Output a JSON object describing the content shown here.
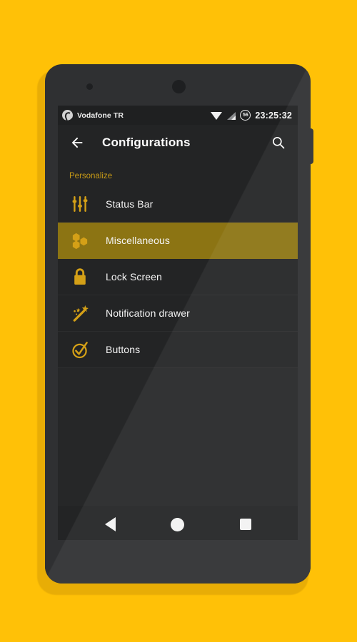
{
  "theme": {
    "background": "#FFC107",
    "accent": "#C79A16",
    "icon_gold": "#D4A017",
    "selected_row": "#8c7413",
    "screen_bg": "#262728",
    "surface": "#232425",
    "status_bar_bg": "#1f2021",
    "text_primary": "#f4f4f4"
  },
  "status_bar": {
    "carrier": "Vodafone TR",
    "carrier_logo_icon": "vodafone-logo-icon",
    "wifi_icon": "wifi-icon",
    "signal_icon": "cell-signal-icon",
    "battery_level": "56",
    "battery_icon": "circle-battery-icon",
    "clock": "23:25:32"
  },
  "app_bar": {
    "back_icon": "arrow-back-icon",
    "title": "Configurations",
    "search_icon": "search-icon"
  },
  "list": {
    "section_header": "Personalize",
    "items": [
      {
        "label": "Status Bar",
        "icon": "sliders-icon",
        "selected": false
      },
      {
        "label": "Miscellaneous",
        "icon": "honeycomb-icon",
        "selected": true
      },
      {
        "label": "Lock Screen",
        "icon": "padlock-icon",
        "selected": false
      },
      {
        "label": "Notification drawer",
        "icon": "magic-wand-icon",
        "selected": false
      },
      {
        "label": "Buttons",
        "icon": "check-circle-icon",
        "selected": false
      }
    ]
  },
  "nav_bar": {
    "back_label": "Back",
    "back_icon": "nav-back-triangle-icon",
    "home_label": "Home",
    "home_icon": "nav-home-circle-icon",
    "recents_label": "Recents",
    "recents_icon": "nav-recents-square-icon"
  }
}
